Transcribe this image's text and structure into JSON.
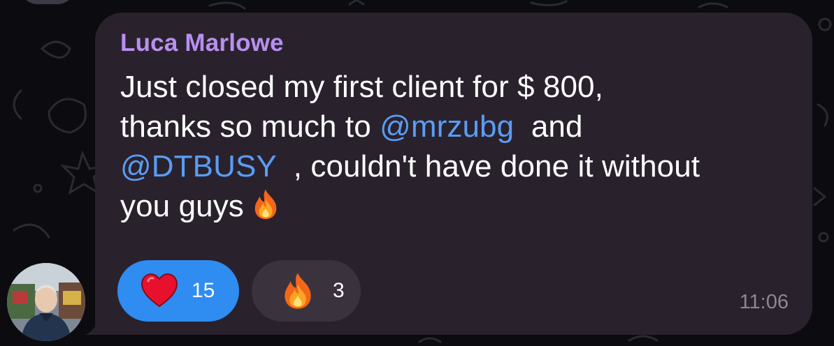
{
  "message": {
    "sender": "Luca Marlowe",
    "parts": {
      "line1": "Just closed my first client for $ 800,",
      "line2_start": "thanks so much to ",
      "mention1": "@mrzubg",
      "line2_end": "  and",
      "mention2": "@DTBUSY",
      "line3_end": "  , couldn't have done it without",
      "line4": "you guys"
    },
    "inline_emoji": "fire-emoji",
    "time": "11:06"
  },
  "reactions": [
    {
      "emoji": "heart-emoji",
      "count": "15",
      "selected": true
    },
    {
      "emoji": "fire-emoji",
      "count": "3",
      "selected": false
    }
  ],
  "colors": {
    "bubble": "#29222d",
    "sender": "#b88ff0",
    "mention": "#5b9cf5",
    "selected_reaction": "#2f8cf1",
    "reaction": "#3a333e",
    "timestamp": "#8e8791"
  }
}
